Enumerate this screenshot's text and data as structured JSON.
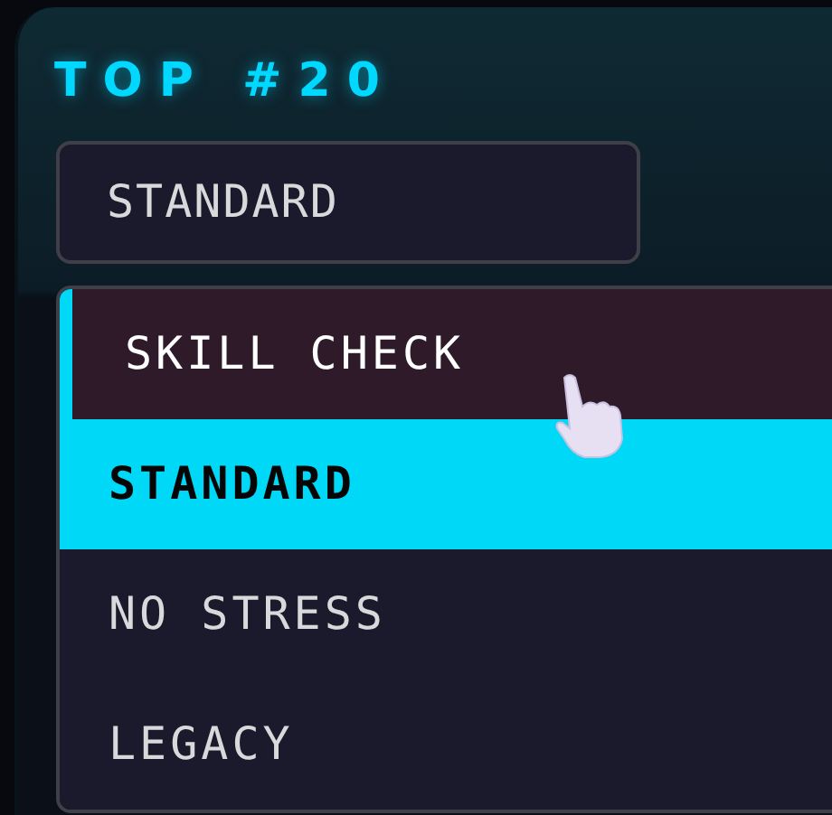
{
  "title": "TOP #20",
  "select": {
    "value": "STANDARD",
    "expanded": true
  },
  "options": [
    {
      "label": "SKILL CHECK",
      "selected": false,
      "hovered": true
    },
    {
      "label": "STANDARD",
      "selected": true,
      "hovered": false
    },
    {
      "label": "NO STRESS",
      "selected": false,
      "hovered": false
    },
    {
      "label": "LEGACY",
      "selected": false,
      "hovered": false
    }
  ]
}
